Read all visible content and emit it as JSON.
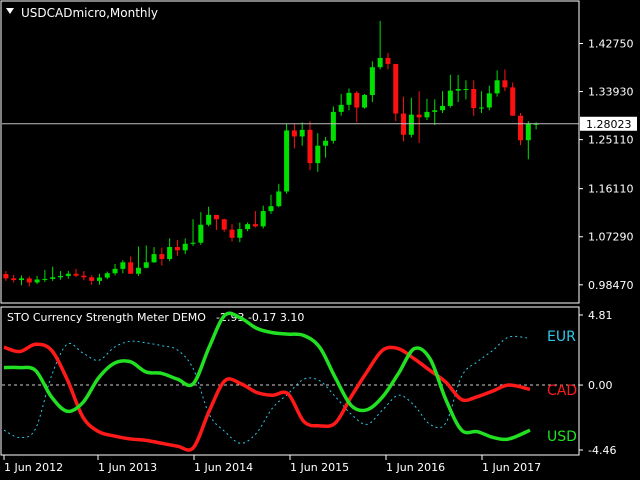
{
  "window": {
    "symbol_title": "USDCADmicro,Monthly",
    "dropdown_icon": "triangle-down-icon"
  },
  "indicator": {
    "title": "STO Currency Strength Meter DEMO",
    "values_text": "-2.93 -0.17 3.10",
    "axis_labels": [
      "4.81",
      "0.00",
      "-4.46"
    ],
    "legend": [
      {
        "name": "EUR",
        "color": "#2fc7ea"
      },
      {
        "name": "CAD",
        "color": "#ff1a1a"
      },
      {
        "name": "USD",
        "color": "#22e022"
      }
    ]
  },
  "price": {
    "current": "1.28023",
    "axis_labels": [
      "1.42750",
      "1.33930",
      "1.25110",
      "1.16110",
      "1.07290",
      "0.98470"
    ]
  },
  "time_axis": [
    "1 Jun 2012",
    "1 Jun 2013",
    "1 Jun 2014",
    "1 Jun 2015",
    "1 Jun 2016",
    "1 Jun 2017"
  ],
  "colors": {
    "bull": "#00e000",
    "bear": "#ff1010",
    "grid": "#ffffff",
    "bg": "#000000"
  },
  "chart_data": [
    {
      "type": "candlestick",
      "title": "USDCADmicro,Monthly",
      "ylim": [
        0.955,
        1.5
      ],
      "x": [
        "2012-01",
        "2012-02",
        "2012-03",
        "2012-04",
        "2012-05",
        "2012-06",
        "2012-07",
        "2012-08",
        "2012-09",
        "2012-10",
        "2012-11",
        "2012-12",
        "2013-01",
        "2013-02",
        "2013-03",
        "2013-04",
        "2013-05",
        "2013-06",
        "2013-07",
        "2013-08",
        "2013-09",
        "2013-10",
        "2013-11",
        "2013-12",
        "2014-01",
        "2014-02",
        "2014-03",
        "2014-04",
        "2014-05",
        "2014-06",
        "2014-07",
        "2014-08",
        "2014-09",
        "2014-10",
        "2014-11",
        "2014-12",
        "2015-01",
        "2015-02",
        "2015-03",
        "2015-04",
        "2015-05",
        "2015-06",
        "2015-07",
        "2015-08",
        "2015-09",
        "2015-10",
        "2015-11",
        "2015-12",
        "2016-01",
        "2016-02",
        "2016-03",
        "2016-04",
        "2016-05",
        "2016-06",
        "2016-07",
        "2016-08",
        "2016-09",
        "2016-10",
        "2016-11",
        "2016-12",
        "2017-01",
        "2017-02",
        "2017-03",
        "2017-04",
        "2017-05",
        "2017-06",
        "2017-07",
        "2017-08",
        "2017-09"
      ],
      "open": [
        1.0045,
        0.9965,
        0.9935,
        0.9965,
        0.989,
        0.9945,
        0.9955,
        0.9985,
        1.001,
        1.005,
        1.0015,
        0.9985,
        0.992,
        0.998,
        1.006,
        1.014,
        1.026,
        1.005,
        1.016,
        1.026,
        1.041,
        1.032,
        1.054,
        1.048,
        1.06,
        1.062,
        1.095,
        1.113,
        1.105,
        1.086,
        1.071,
        1.087,
        1.096,
        1.092,
        1.12,
        1.129,
        1.156,
        1.268,
        1.257,
        1.269,
        1.208,
        1.24,
        1.249,
        1.302,
        1.315,
        1.337,
        1.31,
        1.333,
        1.384,
        1.401,
        1.39,
        1.299,
        1.26,
        1.297,
        1.292,
        1.302,
        1.305,
        1.313,
        1.341,
        1.344,
        1.344,
        1.309,
        1.31,
        1.336,
        1.36,
        1.347,
        1.295,
        1.25,
        1.28
      ],
      "high": [
        1.01,
        1.003,
        1.002,
        1.0,
        1.001,
        1.012,
        1.018,
        1.01,
        1.01,
        1.014,
        1.01,
        1.002,
        1.005,
        1.009,
        1.023,
        1.03,
        1.037,
        1.055,
        1.057,
        1.054,
        1.053,
        1.07,
        1.067,
        1.07,
        1.105,
        1.118,
        1.128,
        1.106,
        1.106,
        1.096,
        1.099,
        1.099,
        1.12,
        1.13,
        1.15,
        1.17,
        1.28,
        1.28,
        1.283,
        1.285,
        1.263,
        1.256,
        1.312,
        1.335,
        1.345,
        1.34,
        1.335,
        1.395,
        1.469,
        1.41,
        1.39,
        1.33,
        1.328,
        1.34,
        1.326,
        1.325,
        1.34,
        1.37,
        1.37,
        1.36,
        1.36,
        1.34,
        1.35,
        1.378,
        1.38,
        1.356,
        1.3,
        1.285,
        1.283
      ],
      "low": [
        0.992,
        0.989,
        0.984,
        0.982,
        0.986,
        0.99,
        0.992,
        0.994,
        0.996,
        0.999,
        0.993,
        0.985,
        0.985,
        0.995,
        1.002,
        1.006,
        1.005,
        1.001,
        1.015,
        1.025,
        1.02,
        1.028,
        1.038,
        1.041,
        1.056,
        1.058,
        1.092,
        1.085,
        1.082,
        1.064,
        1.063,
        1.083,
        1.09,
        1.088,
        1.115,
        1.127,
        1.152,
        1.235,
        1.24,
        1.195,
        1.192,
        1.218,
        1.244,
        1.295,
        1.305,
        1.283,
        1.308,
        1.32,
        1.38,
        1.38,
        1.285,
        1.248,
        1.255,
        1.245,
        1.287,
        1.278,
        1.3,
        1.31,
        1.32,
        1.325,
        1.295,
        1.3,
        1.305,
        1.33,
        1.34,
        1.295,
        1.241,
        1.215,
        1.27
      ],
      "close": [
        0.9965,
        0.9935,
        0.9965,
        0.989,
        0.9945,
        0.9955,
        0.9985,
        1.001,
        1.005,
        1.0015,
        0.9985,
        0.992,
        0.998,
        1.006,
        1.014,
        1.026,
        1.005,
        1.016,
        1.026,
        1.041,
        1.032,
        1.054,
        1.048,
        1.06,
        1.062,
        1.095,
        1.113,
        1.105,
        1.086,
        1.071,
        1.087,
        1.096,
        1.092,
        1.12,
        1.129,
        1.156,
        1.268,
        1.257,
        1.269,
        1.208,
        1.24,
        1.249,
        1.302,
        1.315,
        1.337,
        1.31,
        1.333,
        1.384,
        1.401,
        1.39,
        1.299,
        1.26,
        1.297,
        1.292,
        1.302,
        1.305,
        1.313,
        1.341,
        1.344,
        1.344,
        1.309,
        1.31,
        1.336,
        1.36,
        1.347,
        1.295,
        1.25,
        1.28,
        1.2802
      ]
    },
    {
      "type": "line",
      "title": "STO Currency Strength Meter DEMO",
      "ylim": [
        -4.46,
        4.81
      ],
      "x": [
        0.0,
        0.03,
        0.06,
        0.09,
        0.12,
        0.15,
        0.18,
        0.21,
        0.24,
        0.27,
        0.3,
        0.33,
        0.36,
        0.39,
        0.42,
        0.45,
        0.48,
        0.51,
        0.54,
        0.57,
        0.6,
        0.63,
        0.66,
        0.69,
        0.72,
        0.75,
        0.78,
        0.81,
        0.84,
        0.87,
        0.9,
        0.93,
        0.96,
        1.0
      ],
      "series": [
        {
          "name": "EUR",
          "color": "#2fc7ea",
          "dashed": true,
          "values": [
            -3.1,
            -3.6,
            -3.0,
            0.6,
            2.8,
            2.2,
            1.7,
            2.6,
            3.0,
            2.9,
            2.7,
            2.4,
            1.1,
            -2.0,
            -3.2,
            -4.0,
            -3.3,
            -1.6,
            -0.6,
            0.4,
            0.3,
            -0.8,
            -2.0,
            -2.7,
            -1.7,
            -0.7,
            -1.4,
            -2.7,
            -2.6,
            0.6,
            1.6,
            2.4,
            3.3,
            3.2
          ]
        },
        {
          "name": "CAD",
          "color": "#ff1a1a",
          "dashed": false,
          "values": [
            2.6,
            2.3,
            2.8,
            2.4,
            0.4,
            -2.2,
            -3.2,
            -3.5,
            -3.7,
            -3.8,
            -4.0,
            -4.2,
            -4.3,
            -1.8,
            0.3,
            0.1,
            -0.5,
            -0.7,
            -0.6,
            -2.5,
            -2.8,
            -2.6,
            -0.8,
            0.9,
            2.4,
            2.5,
            1.8,
            1.0,
            0.2,
            -1.0,
            -0.8,
            -0.4,
            0.0,
            -0.3
          ]
        },
        {
          "name": "USD",
          "color": "#22e022",
          "dashed": false,
          "values": [
            1.2,
            1.2,
            1.0,
            -0.8,
            -1.8,
            -1.2,
            0.5,
            1.5,
            1.6,
            0.9,
            0.8,
            0.4,
            0.1,
            2.6,
            4.8,
            4.6,
            3.9,
            3.6,
            3.5,
            3.4,
            2.6,
            0.5,
            -1.4,
            -1.7,
            -0.8,
            0.8,
            2.5,
            1.8,
            -1.0,
            -3.1,
            -3.2,
            -3.6,
            -3.7,
            -3.1
          ]
        }
      ]
    }
  ]
}
